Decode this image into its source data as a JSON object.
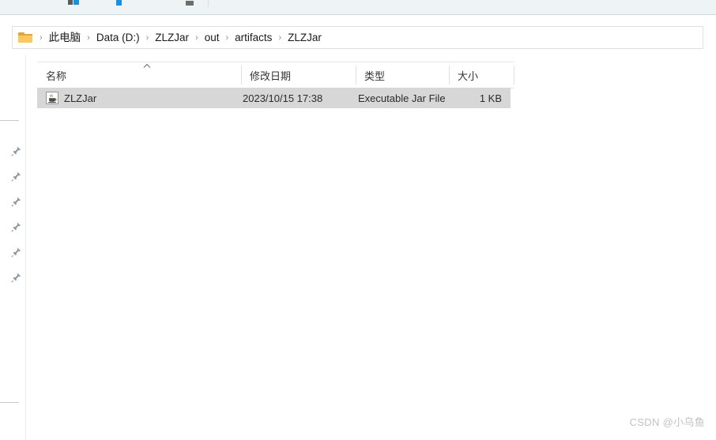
{
  "window": {
    "toolbar": {
      "icons": [
        "share-icon",
        "copy-icon",
        "paste-icon",
        "rename-icon",
        "delete-icon"
      ]
    }
  },
  "address_bar": {
    "folder_icon": "folder-icon",
    "separator": "›",
    "breadcrumbs": [
      {
        "label": "此电脑"
      },
      {
        "label": "Data (D:)"
      },
      {
        "label": "ZLZJar"
      },
      {
        "label": "out"
      },
      {
        "label": "artifacts"
      },
      {
        "label": "ZLZJar"
      }
    ]
  },
  "nav_pane": {
    "pin_icon": "pin-icon",
    "items": [
      {
        "name": "pinned-item-1"
      },
      {
        "name": "pinned-item-2"
      },
      {
        "name": "pinned-item-3"
      },
      {
        "name": "pinned-item-4"
      },
      {
        "name": "pinned-item-5"
      },
      {
        "name": "pinned-item-6"
      }
    ]
  },
  "file_list": {
    "sort_indicator": "chevron-up-icon",
    "columns": [
      {
        "id": "name",
        "label": "名称"
      },
      {
        "id": "date_modified",
        "label": "修改日期"
      },
      {
        "id": "type",
        "label": "类型"
      },
      {
        "id": "size",
        "label": "大小"
      }
    ],
    "rows": [
      {
        "icon": "jar-file-icon",
        "name": "ZLZJar",
        "date_modified": "2023/10/15 17:38",
        "type": "Executable Jar File",
        "size": "1 KB",
        "selected": true
      }
    ]
  },
  "watermark": {
    "text": "CSDN @小乌鱼"
  },
  "colors": {
    "toolbar_bg": "#eef3f6",
    "selection_bg": "#d7d7d7",
    "folder_yellow": "#fbc85c",
    "accent_blue": "#1a8fe0",
    "watermark_grey": "#c2c2c2"
  }
}
